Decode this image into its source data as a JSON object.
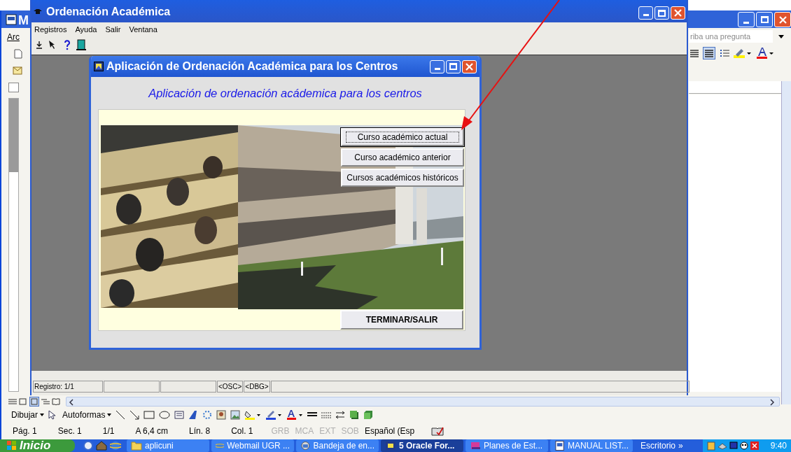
{
  "word_window": {
    "title": "M",
    "menu_partial": "Arc",
    "ask_field": {
      "placeholder": "riba una pregunta"
    },
    "drawing_toolbar": {
      "draw_menu": "Dibujar",
      "autoshapes_menu": "Autoformas"
    },
    "status_bar": {
      "fields": [
        "Pág. 1",
        "Sec. 1",
        "1/1",
        "A 6,4 cm",
        "Lín. 8",
        "Col. 1"
      ],
      "modes": [
        {
          "label": "GRB",
          "on": false
        },
        {
          "label": "MCA",
          "on": false
        },
        {
          "label": "EXT",
          "on": false
        },
        {
          "label": "SOB",
          "on": false
        }
      ],
      "language": "Español (Esp"
    }
  },
  "forms_window": {
    "title": "Ordenación Académica",
    "menu": [
      "Registros",
      "Ayuda",
      "Salir",
      "Ventana"
    ],
    "status_bar": {
      "record": "Registro: 1/1",
      "indicators": [
        "<OSC>",
        "<DBG>"
      ]
    }
  },
  "dialog": {
    "title": "Aplicación de Ordenación Académica para los Centros",
    "heading": "Aplicación de ordenación acádemica para los centros",
    "buttons": [
      {
        "label": "Curso académico actual",
        "focused": true
      },
      {
        "label": "Curso académico anterior",
        "focused": false
      },
      {
        "label": "Cursos académicos históricos",
        "focused": false
      }
    ],
    "exit_button": "TERMINAR/SALIR"
  },
  "taskbar": {
    "start": "Inicio",
    "tasks": [
      {
        "label": "aplicuni",
        "kind": "folder",
        "selected": false
      },
      {
        "label": "Webmail UGR ...",
        "kind": "browser",
        "selected": false
      },
      {
        "label": "Bandeja de en...",
        "kind": "mail",
        "selected": false
      },
      {
        "label": "5 Oracle For...",
        "kind": "app",
        "selected": true
      },
      {
        "label": "Planes de Est...",
        "kind": "books",
        "selected": false
      },
      {
        "label": "MANUAL LIST...",
        "kind": "document",
        "selected": false
      }
    ],
    "desktop": "Escritorio",
    "more": "»",
    "clock": "9:40"
  }
}
